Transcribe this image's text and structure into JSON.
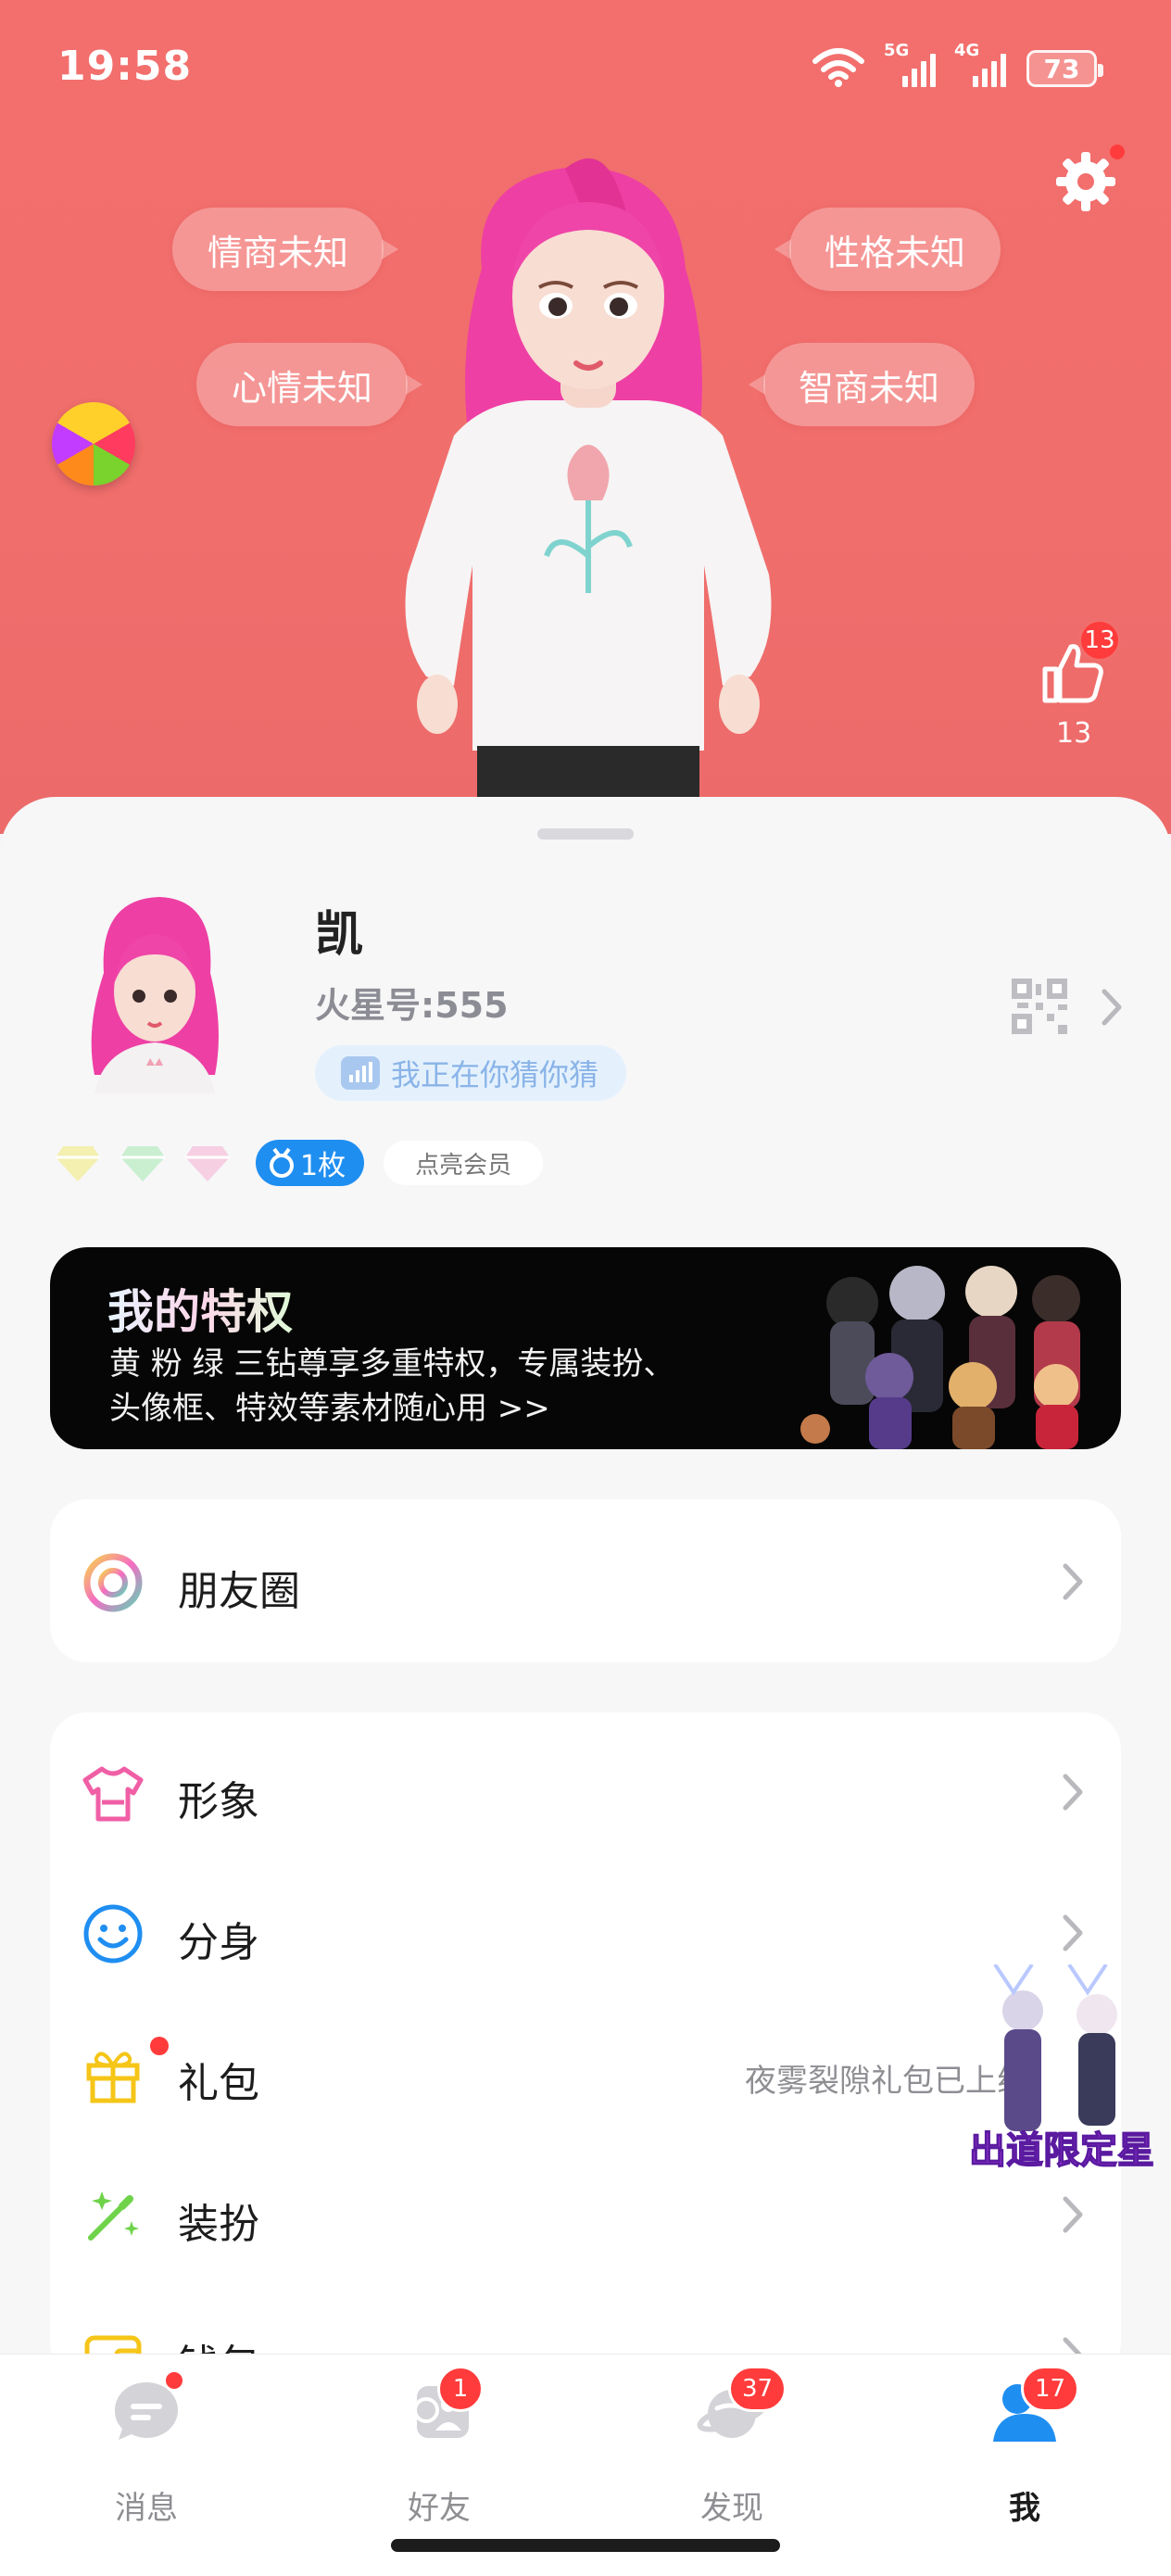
{
  "status_bar": {
    "time": "19:58",
    "net1": "5G",
    "net2": "4G",
    "battery": "73"
  },
  "hero": {
    "bubbles": {
      "eq": "情商未知",
      "personality": "性格未知",
      "mood": "心情未知",
      "iq": "智商未知"
    },
    "like_badge": "13",
    "like_count": "13"
  },
  "profile": {
    "name": "凯",
    "id_label": "火星号:555",
    "status": "我正在你猜你猜",
    "medal": "1枚",
    "vip_button": "点亮会员"
  },
  "privilege": {
    "title": "我的特权",
    "description": "黄 粉 绿 三钻尊享多重特权，专属装扮、头像框、特效等素材随心用 >>"
  },
  "menu": {
    "moments": "朋友圈",
    "items": [
      {
        "label": "形象",
        "icon": "shirt-icon"
      },
      {
        "label": "分身",
        "icon": "smiley-icon"
      },
      {
        "label": "礼包",
        "icon": "gift-icon",
        "note": "夜雾裂隙礼包已上线"
      },
      {
        "label": "装扮",
        "icon": "magic-wand-icon"
      },
      {
        "label": "钱包",
        "icon": "wallet-icon"
      }
    ]
  },
  "floater": {
    "text": "出道限定星"
  },
  "tabbar": {
    "tabs": [
      {
        "label": "消息",
        "icon": "message-icon"
      },
      {
        "label": "好友",
        "icon": "friends-icon",
        "badge": "1"
      },
      {
        "label": "发现",
        "icon": "planet-icon",
        "badge": "37"
      },
      {
        "label": "我",
        "icon": "me-icon",
        "badge": "17"
      }
    ]
  },
  "colors": {
    "hero": "#f26f6d",
    "accent_blue": "#1f8ef1",
    "badge_red": "#ff3b3b"
  }
}
